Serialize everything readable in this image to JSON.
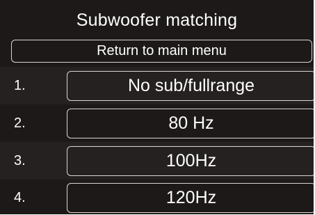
{
  "screen": {
    "title": "Subwoofer matching",
    "return_label": "Return to main menu",
    "options": [
      {
        "number": "1.",
        "label": "No sub/fullrange"
      },
      {
        "number": "2.",
        "label": "80 Hz"
      },
      {
        "number": "3.",
        "label": "100Hz"
      },
      {
        "number": "4.",
        "label": "120Hz"
      }
    ]
  },
  "colors": {
    "background": "#1c1918",
    "text": "#ffffff",
    "border": "#d9d6d2"
  }
}
